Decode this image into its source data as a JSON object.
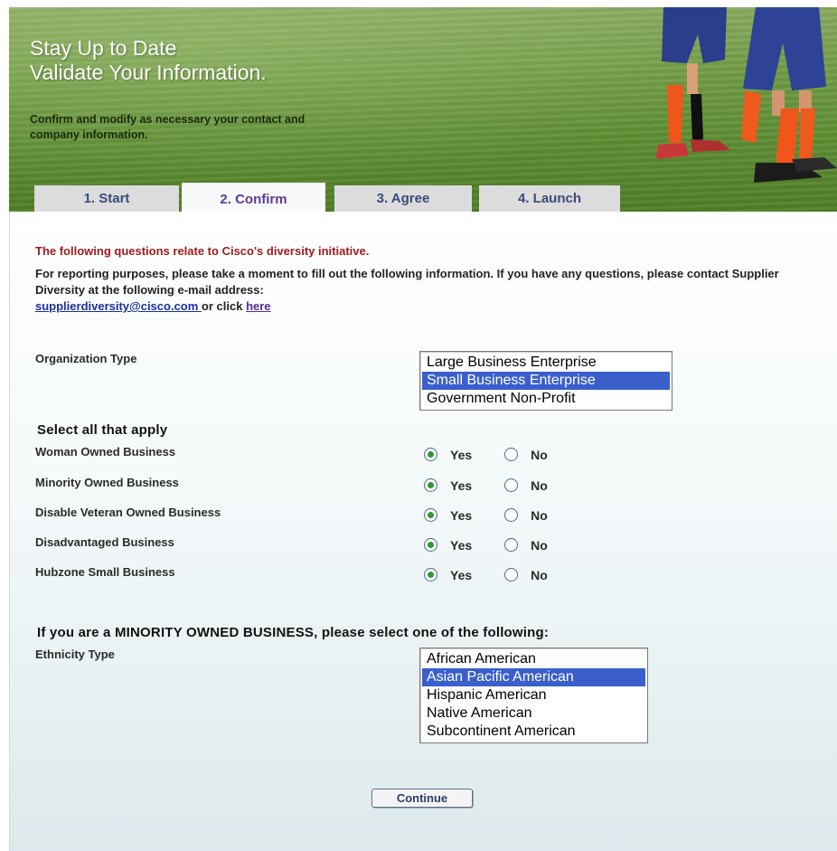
{
  "banner": {
    "title": "Stay Up to Date\nValidate Your Information.",
    "subtitle": "Confirm and modify as necessary your contact and company information."
  },
  "tabs": [
    {
      "label": "1. Start",
      "active": false
    },
    {
      "label": "2. Confirm",
      "active": true
    },
    {
      "label": "3. Agree",
      "active": false
    },
    {
      "label": "4. Launch",
      "active": false
    }
  ],
  "intro": {
    "heading": "The following questions relate to Cisco's diversity initiative.",
    "text": "For reporting purposes, please take a moment to fill out the following information. If you have any questions, please contact Supplier Diversity at the following e-mail address:",
    "email_link": "supplierdiversity@cisco.com ",
    "or_click": " or click ",
    "here_link": "here"
  },
  "organization": {
    "label": "Organization Type",
    "options": [
      "Large Business Enterprise",
      "Small Business Enterprise",
      "Government Non-Profit"
    ],
    "selected": "Small Business Enterprise"
  },
  "select_all": {
    "heading": "Select all that apply",
    "yes_label": "Yes",
    "no_label": "No",
    "items": [
      {
        "label": "Woman Owned Business",
        "value": "Yes"
      },
      {
        "label": "Minority Owned Business",
        "value": "Yes"
      },
      {
        "label": "Disable Veteran Owned Business",
        "value": "Yes"
      },
      {
        "label": "Disadvantaged Business",
        "value": "Yes"
      },
      {
        "label": "Hubzone Small Business",
        "value": "Yes"
      }
    ]
  },
  "minority": {
    "heading": "If you are a MINORITY OWNED BUSINESS, please select one of the following:",
    "label": "Ethnicity Type",
    "options": [
      "African American",
      "Asian Pacific American",
      "Hispanic American",
      "Native American",
      "Subcontinent American"
    ],
    "selected": "Asian Pacific American"
  },
  "continue_label": "Continue",
  "colors": {
    "accent_red": "#9b1b1b",
    "link_blue": "#1a2fa0",
    "selection": "#3a5fcd",
    "radio_checked": "#2f9a31",
    "tab_active_text": "#5a3d8e"
  }
}
